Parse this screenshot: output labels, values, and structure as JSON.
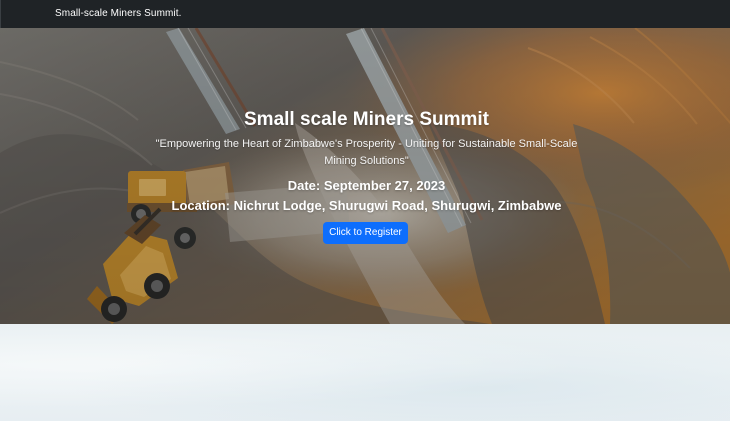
{
  "navbar": {
    "brand": "Small-scale Miners Summit."
  },
  "hero": {
    "title": "Small scale Miners Summit",
    "tagline": "\"Empowering the Heart of Zimbabwe's Prosperity - Uniting for Sustainable Small-Scale Mining Solutions\"",
    "date": "Date: September 27, 2023",
    "location": "Location: Nichrut Lodge, Shurugwi Road, Shurugwi, Zimbabwe",
    "register_label": "Click to Register"
  },
  "colors": {
    "navbar": "#1f2326",
    "button": "#0d6efd",
    "lower_background": "#e8eff2"
  },
  "images": {
    "hero_background": "aerial mining site with loader and dump truck",
    "icons": [
      "loader-icon",
      "dump-truck-icon",
      "conveyor-icon"
    ]
  }
}
